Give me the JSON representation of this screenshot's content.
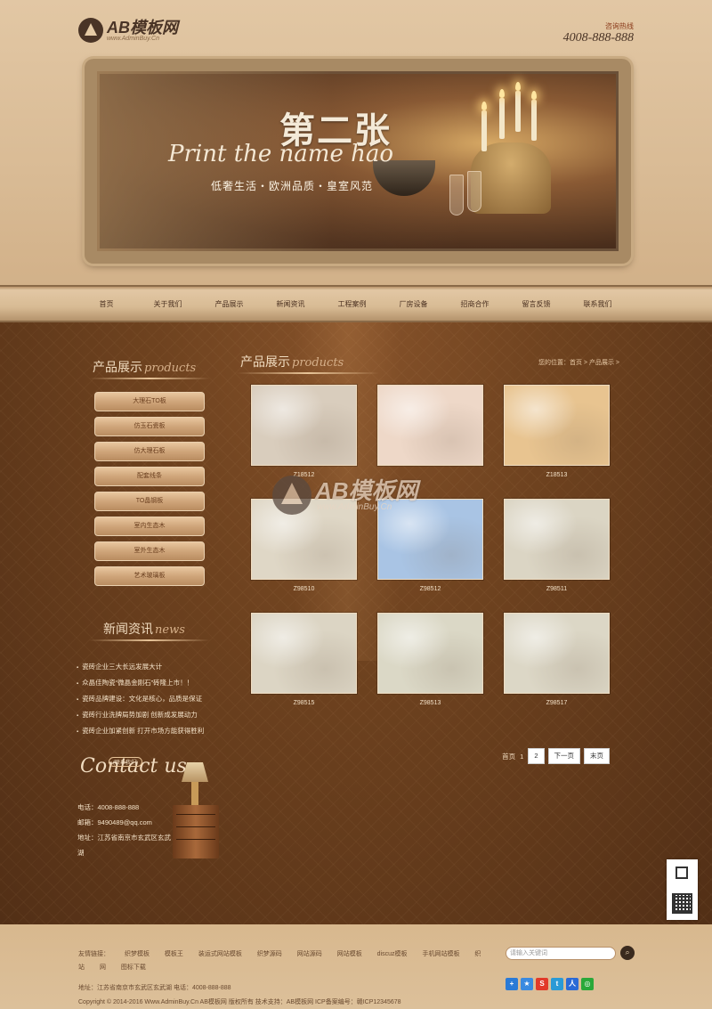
{
  "header": {
    "logo_text": "AB模板网",
    "logo_sub": "www.AdminBuy.Cn",
    "hotline_label": "咨询热线",
    "hotline_number": "4008-888-888"
  },
  "banner": {
    "title": "第二张",
    "script": "Print the name hao",
    "subtitle": "低奢生活・欧洲品质・皇室风范"
  },
  "nav": [
    "首页",
    "关于我们",
    "产品展示",
    "新闻资讯",
    "工程案例",
    "厂房设备",
    "招商合作",
    "留言反馈",
    "联系我们"
  ],
  "sidebar": {
    "products_title": "产品展示",
    "products_script": "products",
    "categories": [
      "大理石TO板",
      "仿玉石瓷板",
      "仿大理石板",
      "配套线条",
      "TO晶钢板",
      "室内生态木",
      "室外生态木",
      "艺术玻璃板"
    ],
    "news_title": "新闻资讯",
    "news_script": "news",
    "news": [
      "瓷砖企业三大长远发展大计",
      "众晶佳陶瓷“微晶金刚石”砖隆上市！！",
      "瓷砖品牌建设：文化是核心，品质是保证",
      "瓷砖行业洗牌局势加剧 创新成发展动力",
      "瓷砖企业加紧创新 打开市场方能获得胜利"
    ],
    "contact_script": "Contact us",
    "contact_tag": "(联系我们)",
    "contact_phone": "电话：4008-888-888",
    "contact_email": "邮箱：9490489@qq.com",
    "contact_addr": "地址：江苏省南京市玄武区玄武湖"
  },
  "content": {
    "title": "产品展示",
    "script": "products",
    "breadcrumb": "您的位置：首页 > 产品展示 >",
    "products": [
      {
        "code": "Z18512",
        "color": "#d9cdbd"
      },
      {
        "code": "",
        "color": "#eed8c8"
      },
      {
        "code": "Z18513",
        "color": "#e8c490"
      },
      {
        "code": "Z98510",
        "color": "#dfd7c6"
      },
      {
        "code": "Z98512",
        "color": "#a9c4e4"
      },
      {
        "code": "Z98511",
        "color": "#dbd5c4"
      },
      {
        "code": "Z98515",
        "color": "#dcd5c4"
      },
      {
        "code": "Z98513",
        "color": "#dbd8c6"
      },
      {
        "code": "Z98517",
        "color": "#dcd7c6"
      }
    ],
    "watermark_main": "AB模板网",
    "watermark_sub": "www.AdminBuy.Cn"
  },
  "pager": {
    "first": "首页",
    "p1": "1",
    "p2": "2",
    "next": "下一页",
    "last": "末页"
  },
  "footer": {
    "links": [
      "友情链接：",
      "织梦模板",
      "模板王",
      "装运式网站模板",
      "织梦源码",
      "网站源码",
      "网站模板",
      "discuz模板",
      "手机网站模板",
      "织站",
      "网",
      "图标下载"
    ],
    "search_placeholder": "请输入关键词",
    "address": "地址：江苏省南京市玄武区玄武湖   电话：4008-888-888",
    "copyright": "Copyright © 2014-2016 Www.AdminBuy.Cn AB模板网 版权所有   技术支持：AB模板网   ICP备案编号：赣ICP12345678"
  },
  "colors": {
    "accent": "#6e421f",
    "gold": "#e8c498"
  }
}
